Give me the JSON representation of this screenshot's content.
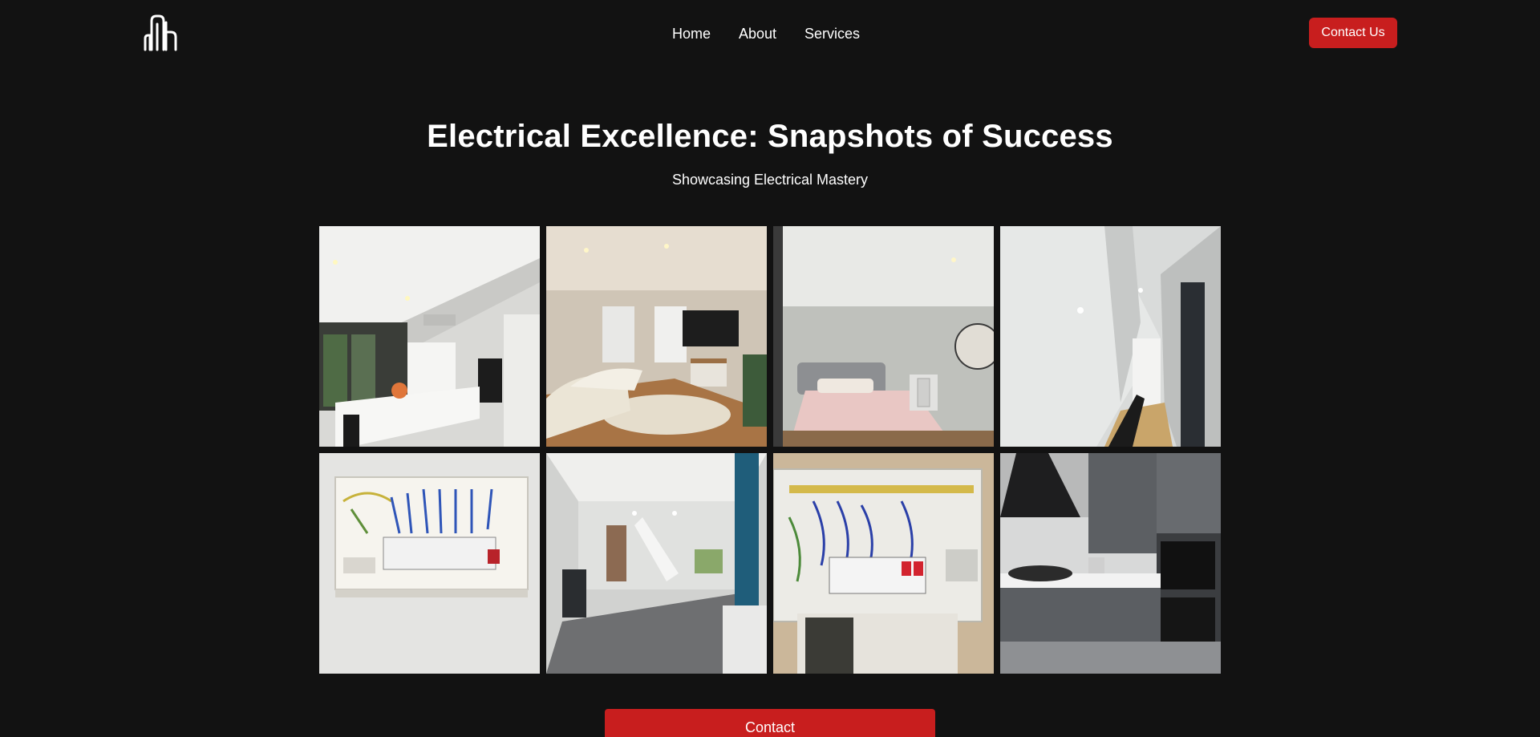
{
  "header": {
    "logo_icon": "dnb-building-logo-icon",
    "nav": [
      {
        "label": "Home"
      },
      {
        "label": "About"
      },
      {
        "label": "Services"
      }
    ],
    "cta_label": "Contact Us"
  },
  "hero": {
    "title": "Electrical Excellence: Snapshots of Success",
    "subtitle": "Showcasing Electrical Mastery"
  },
  "gallery": {
    "tiles": [
      {
        "subject": "kitchen-extension-photo"
      },
      {
        "subject": "living-room-photo"
      },
      {
        "subject": "bedroom-photo"
      },
      {
        "subject": "hallway-stairs-photo"
      },
      {
        "subject": "consumer-unit-wiring-photo"
      },
      {
        "subject": "open-plan-room-photo"
      },
      {
        "subject": "fuse-board-install-photo"
      },
      {
        "subject": "grey-kitchen-photo"
      }
    ]
  },
  "footer_cta": {
    "label": "Contact"
  },
  "colors": {
    "background": "#121212",
    "accent_red": "#c81e1e",
    "text": "#ffffff"
  }
}
